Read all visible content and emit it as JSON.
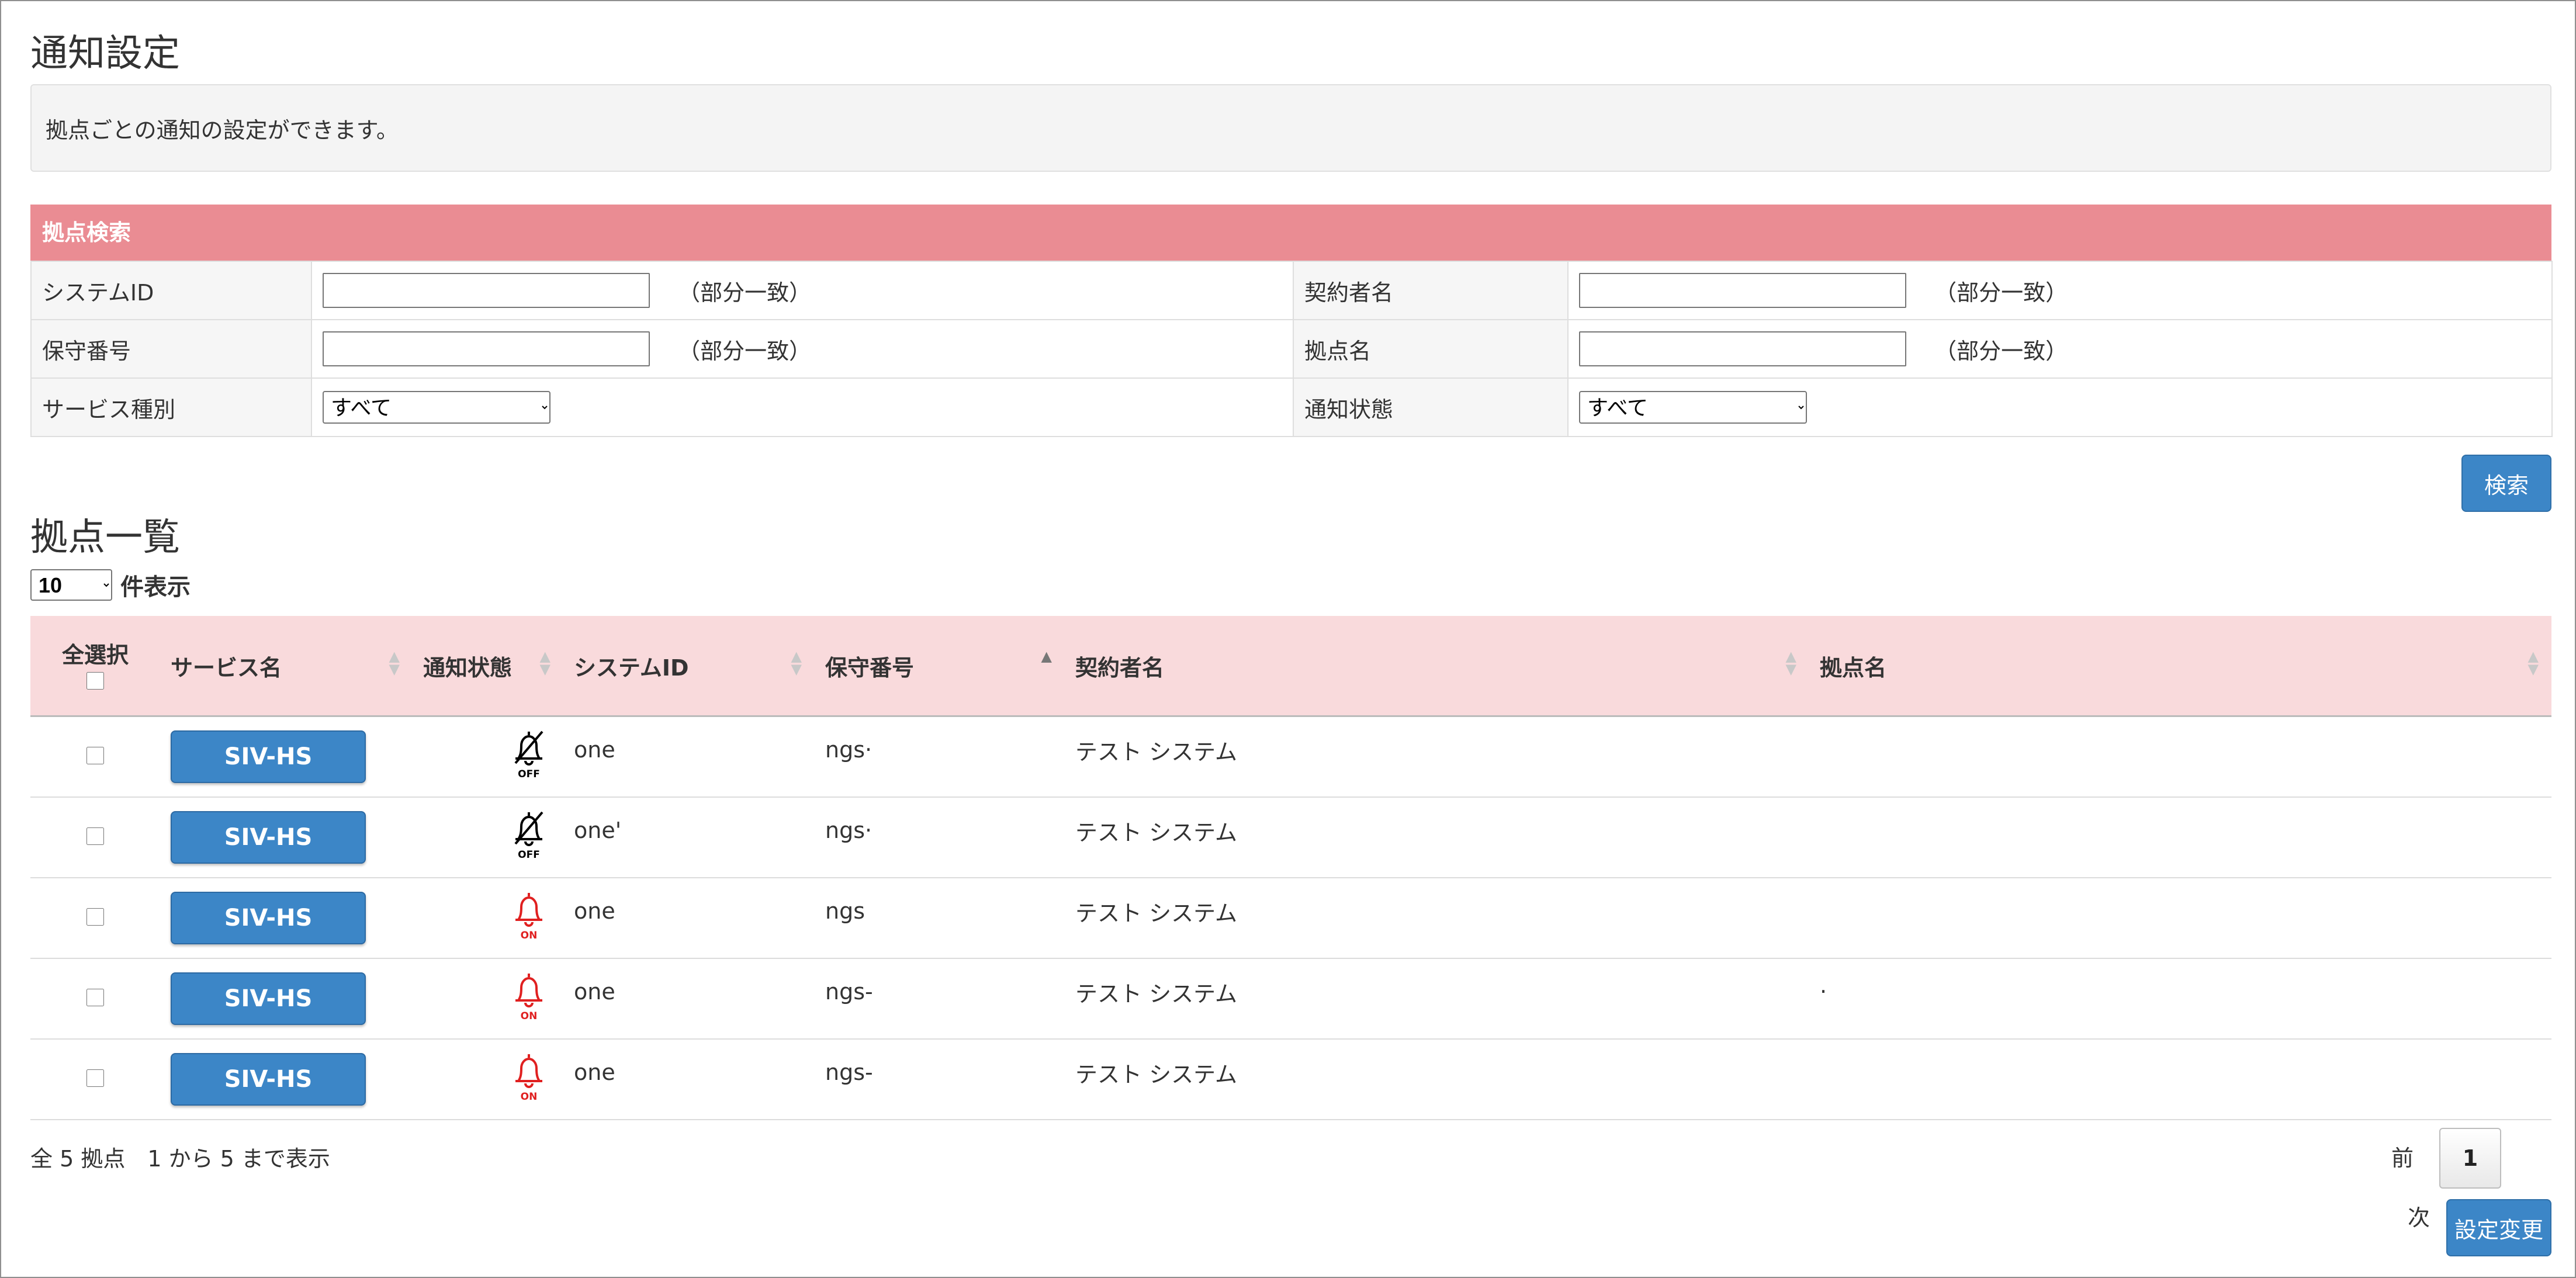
{
  "page": {
    "title": "通知設定",
    "description": "拠点ごとの通知の設定ができます。"
  },
  "search": {
    "header": "拠点検索",
    "system_id_label": "システムID",
    "contractor_label": "契約者名",
    "maintenance_no_label": "保守番号",
    "site_name_label": "拠点名",
    "service_type_label": "サービス種別",
    "notify_status_label": "通知状態",
    "partial_match": "（部分一致）",
    "service_type_value": "すべて",
    "notify_status_value": "すべて",
    "search_button": "検索"
  },
  "list": {
    "title": "拠点一覧",
    "per_page_value": "10",
    "per_page_suffix": "件表示",
    "columns": {
      "select_all": "全選択",
      "service": "サービス名",
      "notify": "通知状態",
      "system_id": "システムID",
      "maintenance_no": "保守番号",
      "contractor": "契約者名",
      "site": "拠点名"
    },
    "rows": [
      {
        "service": "SIV-HS",
        "notify": "OFF",
        "system_id": "one",
        "maintenance_no": "ngs·",
        "contractor": "テスト システム",
        "site": ""
      },
      {
        "service": "SIV-HS",
        "notify": "OFF",
        "system_id": "one'",
        "maintenance_no": "ngs·",
        "contractor": "テスト システム",
        "site": ""
      },
      {
        "service": "SIV-HS",
        "notify": "ON",
        "system_id": "one",
        "maintenance_no": "ngs",
        "contractor": "テスト システム",
        "site": ""
      },
      {
        "service": "SIV-HS",
        "notify": "ON",
        "system_id": "one",
        "maintenance_no": "ngs-",
        "contractor": "テスト システム",
        "site": "·"
      },
      {
        "service": "SIV-HS",
        "notify": "ON",
        "system_id": "one",
        "maintenance_no": "ngs-",
        "contractor": "テスト システム",
        "site": ""
      }
    ],
    "summary": "全 5 拠点　1 から 5 まで表示",
    "pager": {
      "prev": "前",
      "current": "1",
      "next": "次"
    },
    "change_button": "設定変更"
  },
  "colors": {
    "search_header_bg": "#ea8c93",
    "table_header_bg": "#f9dadc",
    "button_blue": "#3c86c7",
    "bell_on": "#e02020",
    "bell_off": "#000000"
  }
}
